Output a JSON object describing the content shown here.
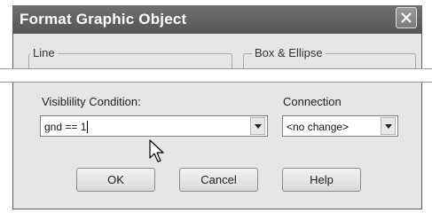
{
  "dialog": {
    "title": "Format Graphic Object",
    "close_icon": "close-icon"
  },
  "groups": {
    "line_label": "Line",
    "box_label": "Box & Ellipse"
  },
  "visibility": {
    "label": "Visiblility Condition:",
    "value": "gnd == 1"
  },
  "connection": {
    "label": "Connection",
    "value": "<no change>"
  },
  "buttons": {
    "ok": "OK",
    "cancel": "Cancel",
    "help": "Help"
  },
  "icons": {
    "dropdown": "chevron-down-icon",
    "pointer": "mouse-pointer-icon"
  }
}
